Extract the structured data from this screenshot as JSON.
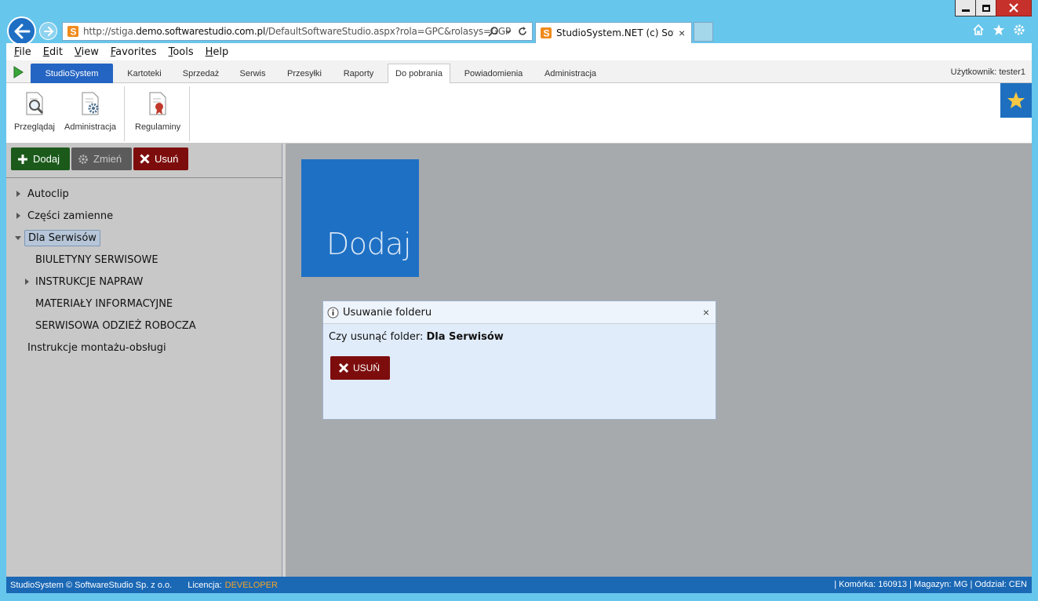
{
  "browser": {
    "url_prefix": "http://stiga.",
    "url_domain": "demo.softwarestudio.com.pl",
    "url_path": "/DefaultSoftwareStudio.aspx?rola=GPC&rolasys=GGP",
    "tab_title": "StudioSystem.NET (c) Soft...",
    "tab_close": "×"
  },
  "menu": {
    "file": "ile",
    "file_acc": "F",
    "edit": "dit",
    "edit_acc": "E",
    "view": "iew",
    "view_acc": "V",
    "favorites": "avorites",
    "favorites_acc": "F",
    "tools": "ools",
    "tools_acc": "T",
    "help": "elp",
    "help_acc": "H"
  },
  "apptabs": {
    "studio": "StudioSystem",
    "items": [
      "Kartoteki",
      "Sprzedaż",
      "Serwis",
      "Przesyłki",
      "Raporty",
      "Do pobrania",
      "Powiadomienia",
      "Administracja"
    ],
    "active": "Do pobrania",
    "user": "Użytkownik: tester1"
  },
  "ribbon": {
    "browse": "Przeglądaj",
    "admin": "Administracja",
    "rules": "Regulaminy"
  },
  "toolbar": {
    "add": "Dodaj",
    "edit": "Zmień",
    "delete": "Usuń"
  },
  "tree": {
    "items": [
      "Autoclip",
      "Części zamienne",
      "Dla Serwisów",
      "BIULETYNY SERWISOWE",
      "INSTRUKCJE NAPRAW",
      "MATERIAŁY INFORMACYJNE",
      "SERWISOWA ODZIEŻ ROBOCZA",
      "Instrukcje montażu-obsługi"
    ]
  },
  "tile": {
    "label": "Dodaj"
  },
  "dialog": {
    "title": "Usuwanie folderu",
    "message_prefix": "Czy usunąć folder:",
    "folder_name": "Dla Serwisów",
    "button": "USUŃ",
    "close": "×"
  },
  "status": {
    "copyright": "StudioSystem © SoftwareStudio Sp. z o.o.",
    "license_label": "Licencja:",
    "license_value": "DEVELOPER",
    "right": "| Komórka: 160913 | Magazyn: MG | Oddział: CEN"
  },
  "colors": {
    "accent": "#1e70c4",
    "danger": "#7d0d0d",
    "success": "#1b5a1b",
    "license": "#f5a623"
  }
}
